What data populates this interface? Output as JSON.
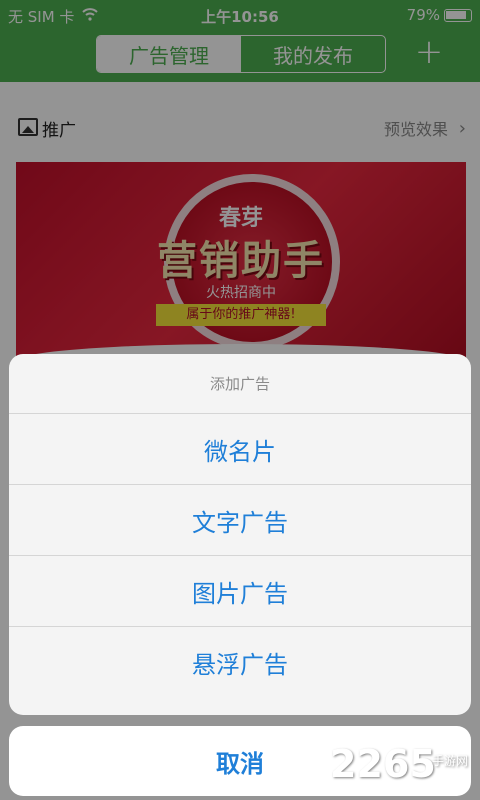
{
  "status_bar": {
    "carrier": "无 SIM 卡",
    "time": "上午10:56",
    "battery": "79%"
  },
  "header": {
    "tabs": [
      {
        "label": "广告管理",
        "active": true
      },
      {
        "label": "我的发布",
        "active": false
      }
    ],
    "add_label": "+"
  },
  "promo": {
    "label": "推广",
    "preview_label": "预览效果",
    "chevron": "›"
  },
  "banner": {
    "line1": "春芽",
    "line2": "营销助手",
    "line3": "火热招商中",
    "line4": "属于你的推广神器!"
  },
  "action_sheet": {
    "title": "添加广告",
    "options": [
      "微名片",
      "文字广告",
      "图片广告",
      "悬浮广告"
    ],
    "cancel": "取消"
  },
  "watermark": {
    "text": "2265",
    "sub": "手游网"
  },
  "colors": {
    "header_green": "#4caf50",
    "action_blue": "#1f7fd8"
  }
}
